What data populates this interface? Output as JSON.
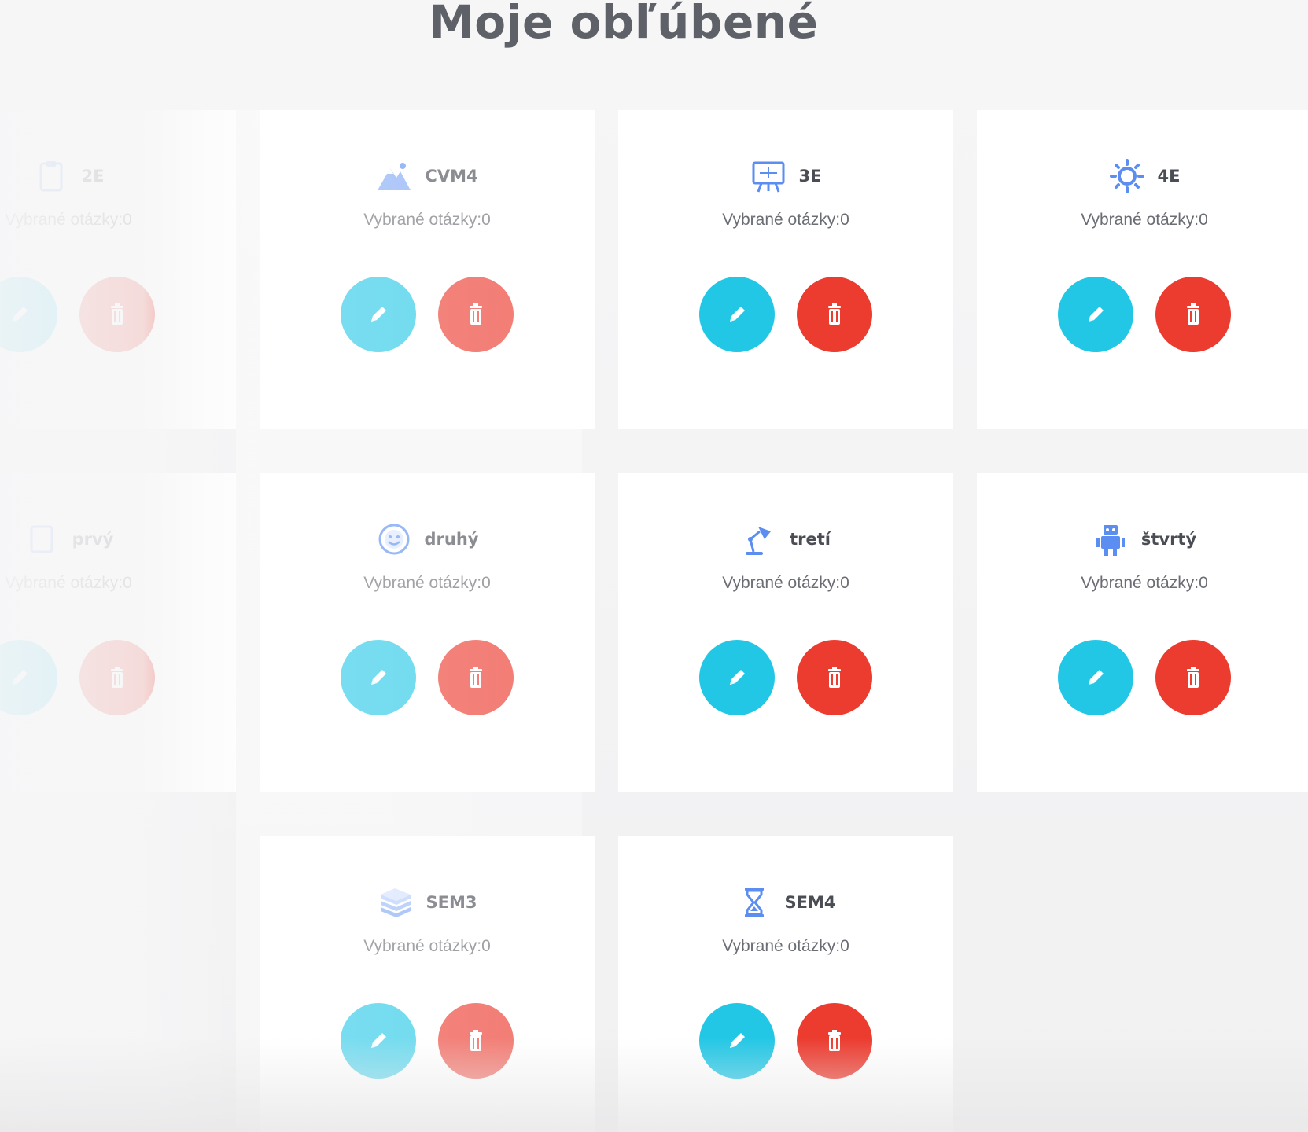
{
  "page": {
    "title": "Moje obľúbené"
  },
  "subtitle_label": "Vybrané otázky:",
  "colors": {
    "edit": "#23c7e6",
    "delete": "#ec3b2f",
    "icon": "#5b8ef0"
  },
  "cards": [
    {
      "title": "2E",
      "icon": "clipboard-icon",
      "selected_count": "0"
    },
    {
      "title": "CVM4",
      "icon": "mountain-icon",
      "selected_count": "0"
    },
    {
      "title": "3E",
      "icon": "presentation-board-icon",
      "selected_count": "0"
    },
    {
      "title": "4E",
      "icon": "sun-gear-icon",
      "selected_count": "0"
    },
    {
      "title": "prvý",
      "icon": "book-icon",
      "selected_count": "0"
    },
    {
      "title": "druhý",
      "icon": "smiley-icon",
      "selected_count": "0"
    },
    {
      "title": "tretí",
      "icon": "desk-lamp-icon",
      "selected_count": "0"
    },
    {
      "title": "štvrtý",
      "icon": "robot-icon",
      "selected_count": "0"
    },
    {
      "title": "",
      "icon": "",
      "selected_count": ""
    },
    {
      "title": "SEM3",
      "icon": "stack-of-books-icon",
      "selected_count": "0"
    },
    {
      "title": "SEM4",
      "icon": "hourglass-icon",
      "selected_count": "0"
    }
  ]
}
